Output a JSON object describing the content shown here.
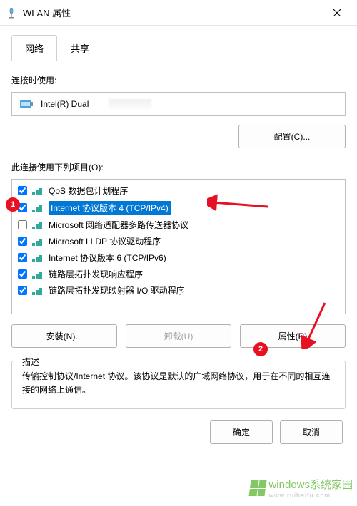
{
  "window": {
    "title": "WLAN 属性"
  },
  "tabs": {
    "network": "网络",
    "sharing": "共享"
  },
  "connectUsing": {
    "label": "连接时使用:",
    "adapter": "Intel(R) Dual",
    "configure": "配置(C)..."
  },
  "itemsSection": {
    "label": "此连接使用下列项目(O):",
    "items": [
      {
        "checked": true,
        "label": "QoS 数据包计划程序"
      },
      {
        "checked": true,
        "label": "Internet 协议版本 4 (TCP/IPv4)"
      },
      {
        "checked": false,
        "label": "Microsoft 网络适配器多路传送器协议"
      },
      {
        "checked": true,
        "label": "Microsoft LLDP 协议驱动程序"
      },
      {
        "checked": true,
        "label": "Internet 协议版本 6 (TCP/IPv6)"
      },
      {
        "checked": true,
        "label": "链路层拓扑发现响应程序"
      },
      {
        "checked": true,
        "label": "链路层拓扑发现映射器 I/O 驱动程序"
      }
    ]
  },
  "actions": {
    "install": "安装(N)...",
    "uninstall": "卸载(U)",
    "properties": "属性(R)"
  },
  "description": {
    "legend": "描述",
    "text": "传输控制协议/Internet 协议。该协议是默认的广域网络协议，用于在不同的相互连接的网络上通信。"
  },
  "bottom": {
    "ok": "确定",
    "cancel": "取消"
  },
  "annotations": {
    "badge1": "1",
    "badge2": "2"
  },
  "watermark": {
    "text": "windows系统家园",
    "sub": "www.ruihaifu.com"
  }
}
